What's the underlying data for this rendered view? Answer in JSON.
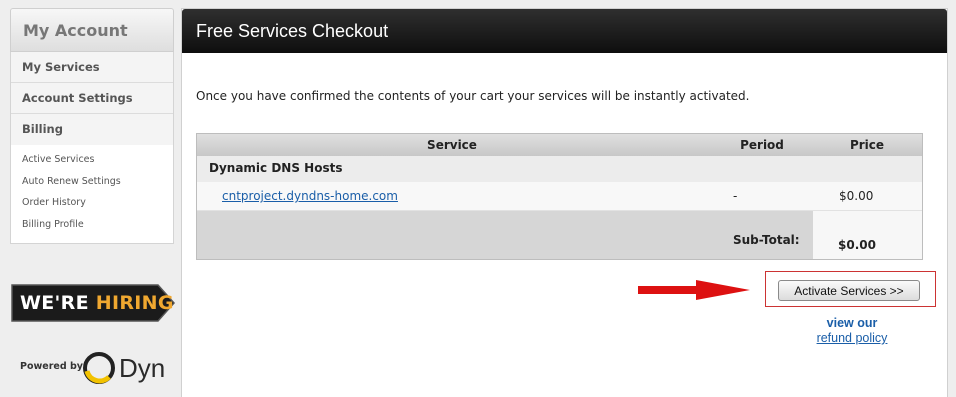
{
  "sidebar": {
    "title": "My Account",
    "items": [
      {
        "label": "My Services"
      },
      {
        "label": "Account Settings"
      },
      {
        "label": "Billing"
      }
    ],
    "sub_items": [
      {
        "label": "Active Services"
      },
      {
        "label": "Auto Renew Settings"
      },
      {
        "label": "Order History"
      },
      {
        "label": "Billing Profile"
      }
    ]
  },
  "promo": {
    "hiring_prefix": "WE'RE ",
    "hiring_highlight": "HIRING"
  },
  "powered_by": {
    "label": "Powered by",
    "brand": "Dyn"
  },
  "main": {
    "title": "Free Services Checkout",
    "intro": "Once you have confirmed the contents of your cart your services will be instantly activated.",
    "table": {
      "headers": {
        "service": "Service",
        "period": "Period",
        "price": "Price"
      },
      "group": "Dynamic DNS Hosts",
      "rows": [
        {
          "service": "cntproject.dyndns-home.com",
          "period": "-",
          "price": "$0.00"
        }
      ],
      "subtotal_label": "Sub-Total:",
      "subtotal_value": "$0.00"
    },
    "activate_label": "Activate Services >>",
    "view_our": "view our",
    "refund_link": "refund policy"
  },
  "colors": {
    "header_bg": "#1a1a1a",
    "link": "#1a5ea8",
    "hiring_highlight": "#f0a830",
    "arrow": "#dd1111",
    "highlight_box": "#cc3333"
  }
}
